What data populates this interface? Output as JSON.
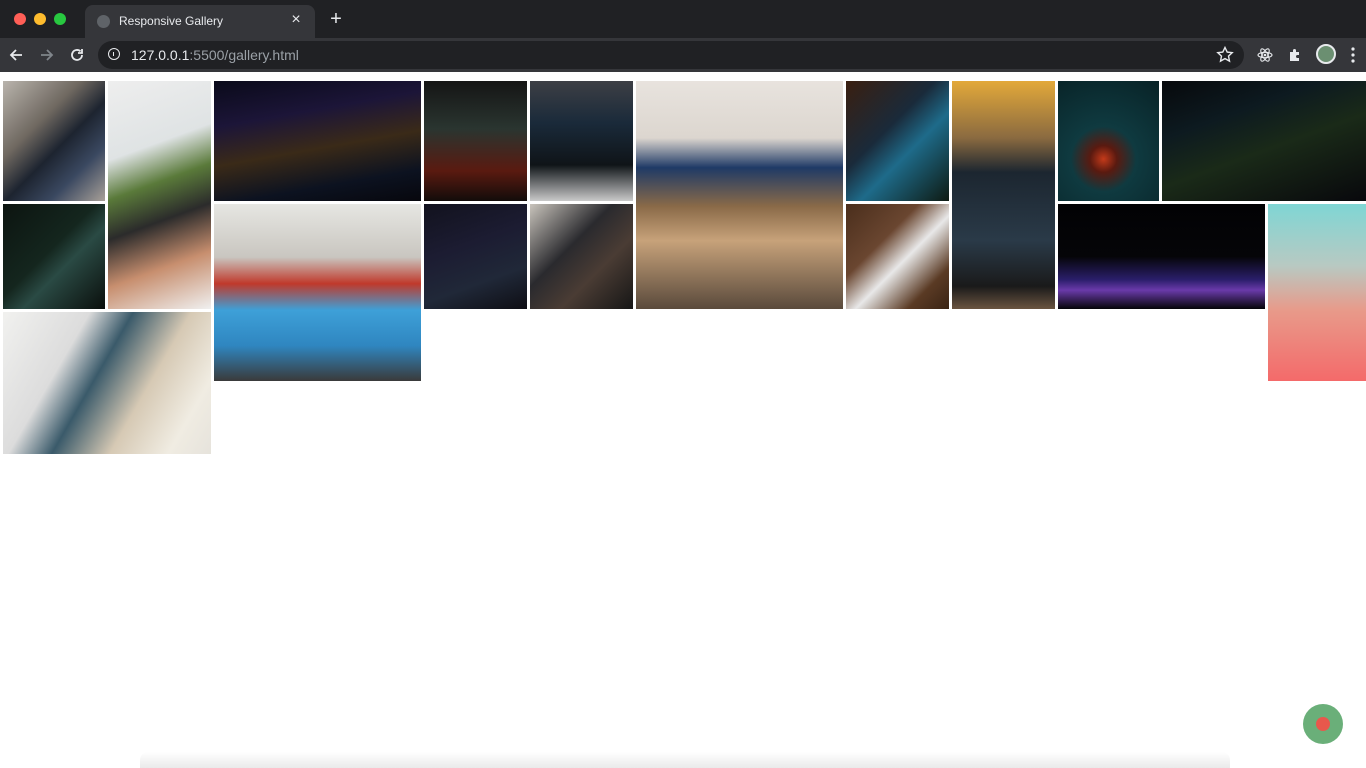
{
  "browser": {
    "tab_title": "Responsive Gallery",
    "tab_close": "×",
    "new_tab": "+",
    "url_host": "127.0.0.1",
    "url_path": ":5500/gallery.html"
  },
  "gallery": {
    "items": [
      {
        "name": "laptop-code-desk-photo"
      },
      {
        "name": "tablet-typing-plant-photo"
      },
      {
        "name": "colorful-code-screen-photo"
      },
      {
        "name": "monitor-code-dark-photo"
      },
      {
        "name": "dual-monitor-setup-photo"
      },
      {
        "name": "wooden-desk-monitor-photo"
      },
      {
        "name": "blurred-code-closeup-photo"
      },
      {
        "name": "laptop-code-yellow-photo"
      },
      {
        "name": "teal-room-object-photo"
      },
      {
        "name": "dark-code-screen-photo"
      },
      {
        "name": "dark-room-monitors-photo"
      },
      {
        "name": "programmers-office-photo"
      },
      {
        "name": "dim-code-screen-photo"
      },
      {
        "name": "man-laptop-coding-photo"
      },
      {
        "name": "laptop-notebook-wood-photo"
      },
      {
        "name": "keyboard-glow-dark-photo"
      },
      {
        "name": "lightbulb-hand-sky-photo"
      },
      {
        "name": "man-dual-screen-office-photo"
      }
    ]
  },
  "colors": {
    "fab_outer": "#6aaf79",
    "fab_inner": "#e8584c"
  }
}
